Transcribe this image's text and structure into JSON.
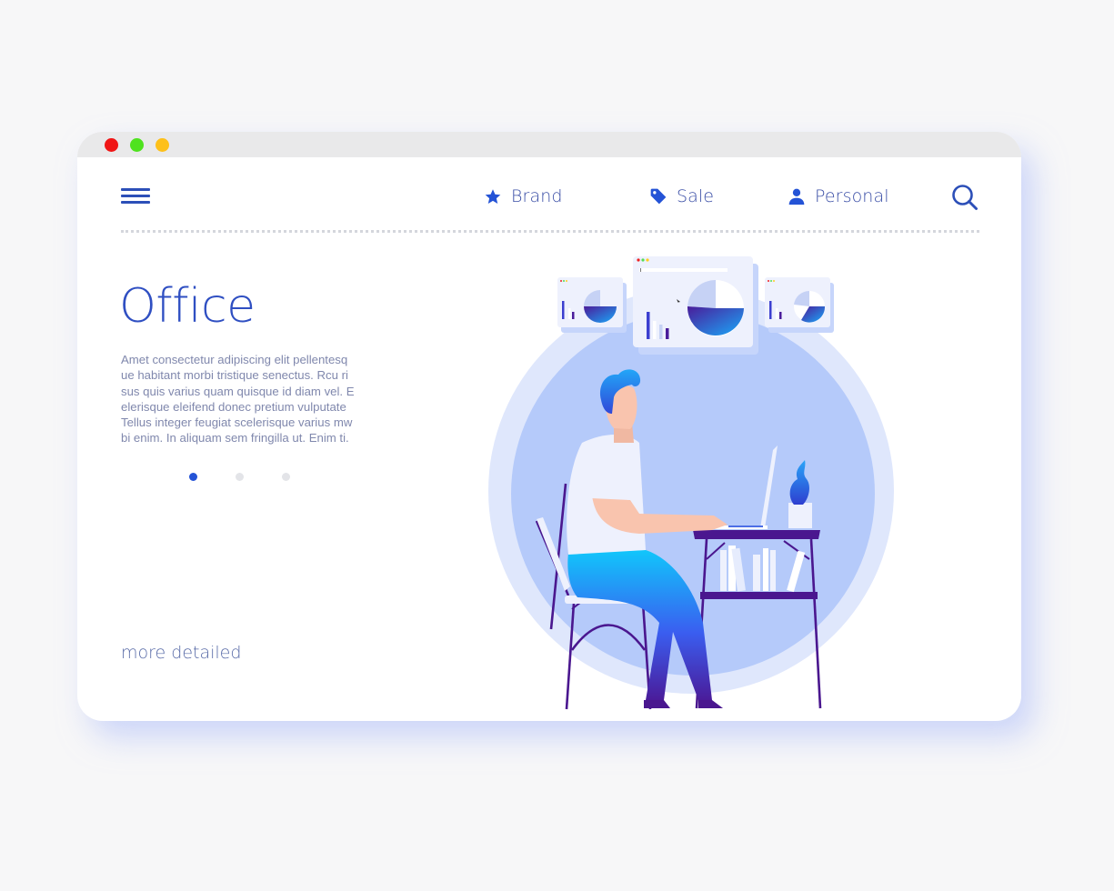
{
  "window": {
    "controls": [
      "close",
      "maximize",
      "minimize"
    ]
  },
  "nav": {
    "menu_icon": "hamburger-menu-icon",
    "items": [
      {
        "label": "Brand",
        "icon": "star-icon"
      },
      {
        "label": "Sale",
        "icon": "tag-icon"
      },
      {
        "label": "Personal",
        "icon": "user-icon"
      }
    ],
    "search_icon": "search-icon"
  },
  "hero": {
    "title": "Office",
    "body": "Amet consectetur adipiscing elit pellentesq\nue habitant morbi tristique senectus. Rcu ri\nsus quis varius quam quisque id diam vel. E\nelerisque eleifend donec pretium vulputate\nTellus integer feugiat scelerisque varius mw\nbi enim. In aliquam sem fringilla ut. Enim ti.",
    "pager": {
      "count": 3,
      "active_index": 0
    },
    "link": "more detailed"
  },
  "illustration": {
    "description": "man-working-at-laptop-desk-with-floating-chart-windows"
  },
  "colors": {
    "accent": "#2f4fc2",
    "text_muted": "#8088ad",
    "circle_outer": "#dfe7fc",
    "circle_inner": "#b5cafa",
    "furniture": "#4a178f",
    "dot_red": "#f01616",
    "dot_green": "#4fe21f",
    "dot_yellow": "#fdc01a"
  }
}
